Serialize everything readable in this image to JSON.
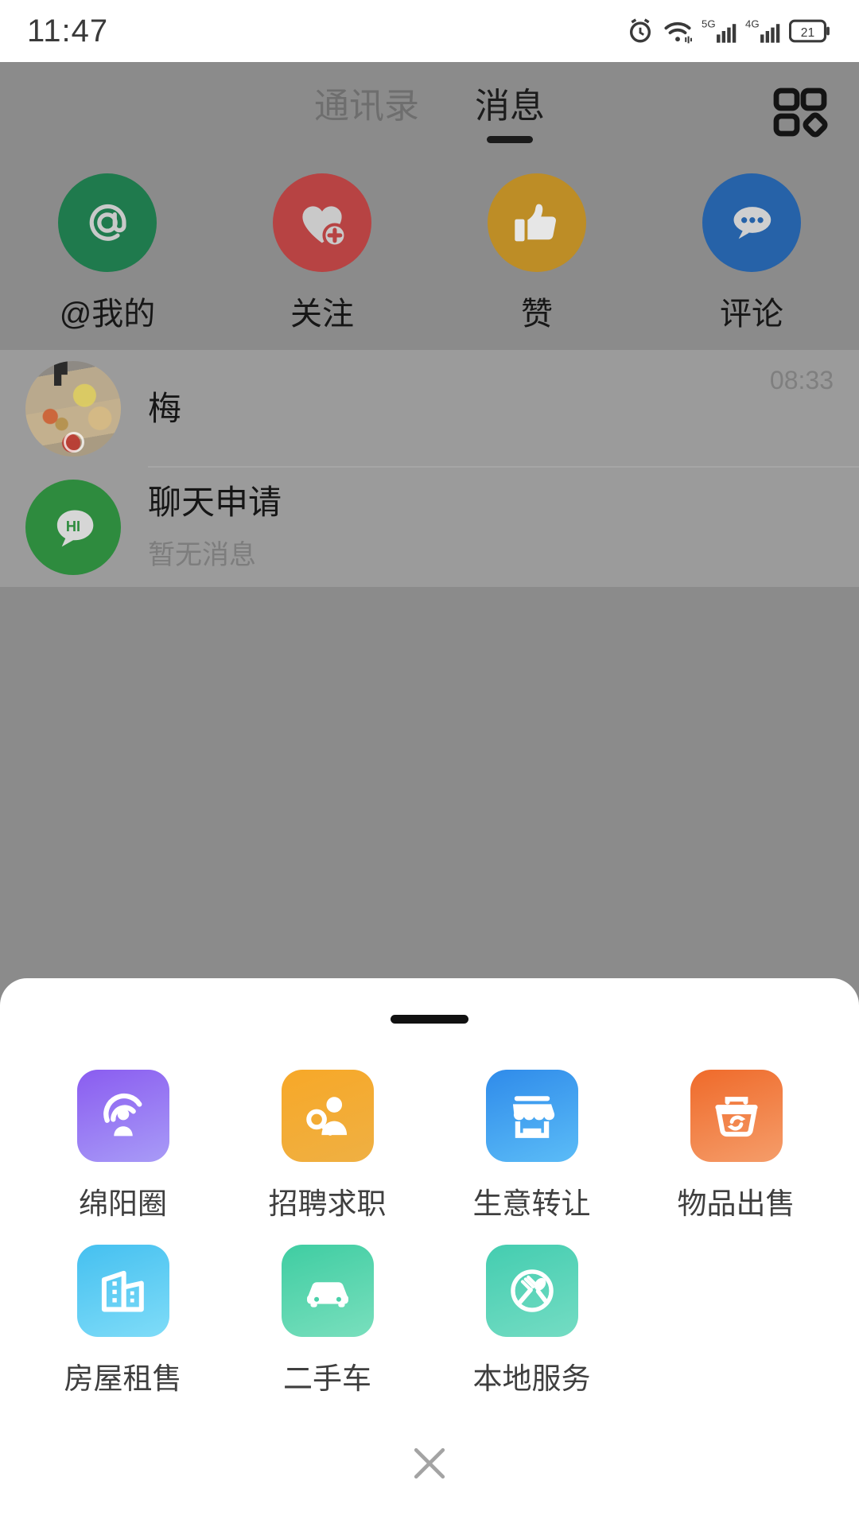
{
  "status_bar": {
    "time": "11:47",
    "icons": [
      "alarm-icon",
      "wifi-icon",
      "signal-5g-icon",
      "signal-4g-icon",
      "battery-icon"
    ],
    "battery_level": "21"
  },
  "app": {
    "tabs": [
      {
        "label": "通讯录",
        "active": false
      },
      {
        "label": "消息",
        "active": true
      }
    ],
    "grid_button": "grid-apps-icon",
    "quick_actions": [
      {
        "label": "@我的",
        "icon": "at-mention-icon",
        "color": "#1f7a4d"
      },
      {
        "label": "关注",
        "icon": "heart-plus-icon",
        "color": "#b74343"
      },
      {
        "label": "赞",
        "icon": "thumbs-up-icon",
        "color": "#bd8d26"
      },
      {
        "label": "评论",
        "icon": "comment-bubble-icon",
        "color": "#2662a8"
      }
    ],
    "chats": [
      {
        "title": "梅",
        "subtitle": "",
        "time": "08:33",
        "avatar": "photo-avatar"
      },
      {
        "title": "聊天申请",
        "subtitle": "暂无消息",
        "time": "",
        "avatar": "hi-bubble-avatar",
        "avatar_text": "HI"
      }
    ]
  },
  "bottom_sheet": {
    "handle": "drag-handle",
    "apps": [
      {
        "label": "绵阳圈",
        "icon": "broadcast-person-icon",
        "color_start": "#8a5cf0",
        "color_end": "#a08cf5"
      },
      {
        "label": "招聘求职",
        "icon": "job-search-icon",
        "color_start": "#f5a623",
        "color_end": "#f0ad3c"
      },
      {
        "label": "生意转让",
        "icon": "storefront-icon",
        "color_start": "#2f8bea",
        "color_end": "#4fb3f5"
      },
      {
        "label": "物品出售",
        "icon": "basket-recycle-icon",
        "color_start": "#ef6a2a",
        "color_end": "#f59055"
      },
      {
        "label": "房屋租售",
        "icon": "buildings-icon",
        "color_start": "#4ec2ef",
        "color_end": "#78d8f7"
      },
      {
        "label": "二手车",
        "icon": "car-icon",
        "color_start": "#4ad1a9",
        "color_end": "#6fdcb6"
      },
      {
        "label": "本地服务",
        "icon": "fork-spoon-plate-icon",
        "color_start": "#4bcdb0",
        "color_end": "#6ed8be"
      }
    ],
    "close_button": "close-icon"
  }
}
